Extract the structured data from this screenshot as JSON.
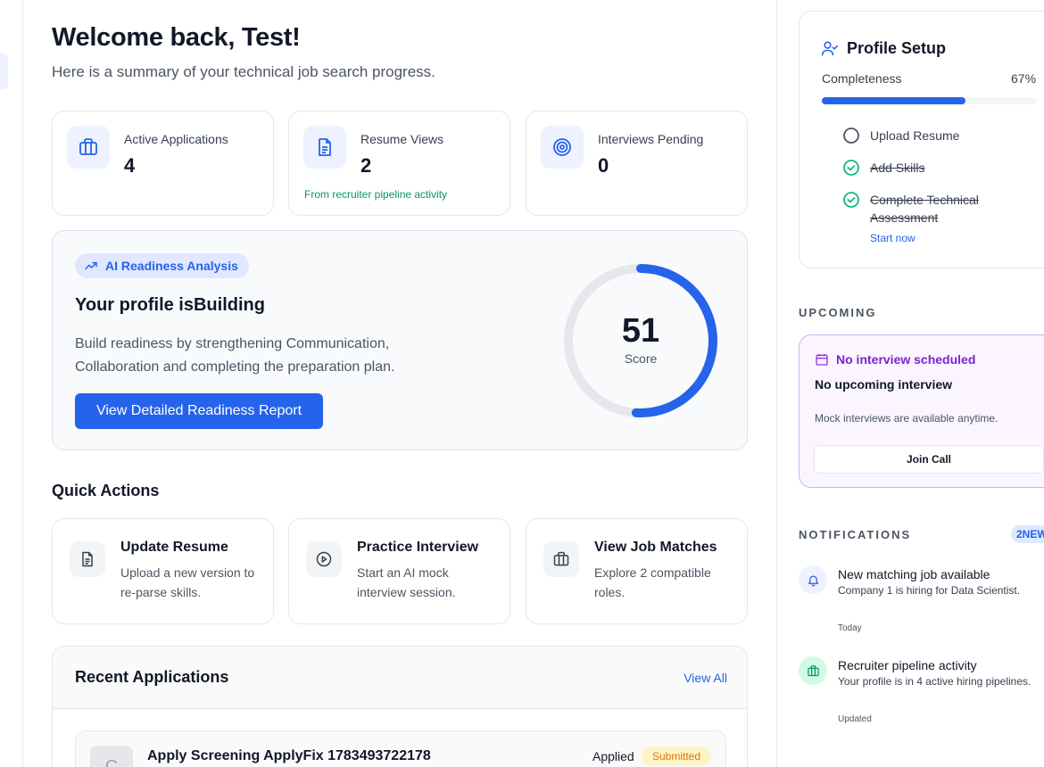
{
  "header": {
    "title": "Welcome back, Test!",
    "subtitle": "Here is a summary of your technical job search progress."
  },
  "stats": [
    {
      "label": "Active Applications",
      "value": "4",
      "icon": "briefcase-icon"
    },
    {
      "label": "Resume Views",
      "value": "2",
      "note": "From recruiter pipeline activity",
      "icon": "document-icon"
    },
    {
      "label": "Interviews Pending",
      "value": "0",
      "icon": "target-icon"
    }
  ],
  "readiness": {
    "pill": "AI Readiness Analysis",
    "title": "Your profile isBuilding",
    "description": "Build readiness by strengthening Communication, Collaboration and completing the preparation plan.",
    "button": "View Detailed Readiness Report",
    "score": "51",
    "score_value": 51,
    "score_label": "Score"
  },
  "quick_actions": {
    "title": "Quick Actions",
    "items": [
      {
        "title": "Update Resume",
        "desc": "Upload a new version to re-parse skills.",
        "icon": "document-icon"
      },
      {
        "title": "Practice Interview",
        "desc": "Start an AI mock interview session.",
        "icon": "play-icon"
      },
      {
        "title": "View Job Matches",
        "desc": "Explore 2 compatible roles.",
        "icon": "briefcase-icon"
      }
    ]
  },
  "recent": {
    "title": "Recent Applications",
    "view_all": "View All",
    "rows": [
      {
        "logo": "C",
        "name": "Apply Screening ApplyFix 1783493722178",
        "status": "Applied",
        "badge": "Submitted"
      }
    ]
  },
  "profile_setup": {
    "title": "Profile Setup",
    "completeness_label": "Completeness",
    "completeness_pct": "67%",
    "completeness_value": 0.67,
    "tasks": [
      {
        "label": "Upload Resume",
        "done": false
      },
      {
        "label": "Add Skills",
        "done": true
      },
      {
        "label": "Complete Technical",
        "label2": "Assessment",
        "done": true
      }
    ],
    "start_link": "Start now"
  },
  "upcoming": {
    "heading": "UPCOMING",
    "title": "No interview scheduled",
    "main": "No upcoming interview",
    "note": "Mock interviews are available anytime.",
    "button": "Join Call"
  },
  "notifications": {
    "heading": "NOTIFICATIONS",
    "badge": "2NEW",
    "items": [
      {
        "title": "New matching job available",
        "desc": "Company 1 is hiring for Data Scientist.",
        "when": "Today",
        "icon": "bell-icon"
      },
      {
        "title": "Recruiter pipeline activity",
        "desc": "Your profile is in 4 active hiring pipelines.",
        "when": "Updated",
        "icon": "briefcase-icon"
      }
    ]
  },
  "colors": {
    "accent": "#2563eb",
    "success": "#059669",
    "purple": "#7e22ce",
    "warning": "#d97706"
  }
}
